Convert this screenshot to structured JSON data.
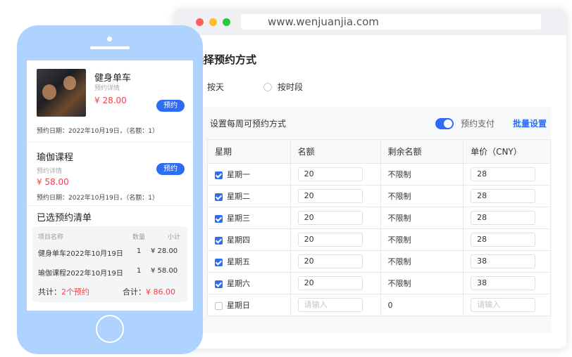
{
  "browser": {
    "url": "www.wenjuanjia.com",
    "section_title": "选择预约方式",
    "modes": [
      {
        "label": "按天",
        "selected": true
      },
      {
        "label": "按时段",
        "selected": false
      }
    ],
    "weekly_title": "设置每周可预约方式",
    "pay_toggle_label": "预约支付",
    "pay_toggle_on": true,
    "batch_label": "批量设置",
    "table": {
      "headers": [
        "星期",
        "名额",
        "剩余名额",
        "单价（CNY）"
      ],
      "rows": [
        {
          "day": "星期一",
          "checked": true,
          "quota": "20",
          "remain": "不限制",
          "price": "28"
        },
        {
          "day": "星期二",
          "checked": true,
          "quota": "20",
          "remain": "不限制",
          "price": "28"
        },
        {
          "day": "星期三",
          "checked": true,
          "quota": "20",
          "remain": "不限制",
          "price": "28"
        },
        {
          "day": "星期四",
          "checked": true,
          "quota": "20",
          "remain": "不限制",
          "price": "28"
        },
        {
          "day": "星期五",
          "checked": true,
          "quota": "20",
          "remain": "不限制",
          "price": "38"
        },
        {
          "day": "星期六",
          "checked": true,
          "quota": "20",
          "remain": "不限制",
          "price": "38"
        },
        {
          "day": "星期日",
          "checked": false,
          "quota": "",
          "remain": "0",
          "price": ""
        }
      ],
      "input_placeholder": "请输入"
    }
  },
  "phone": {
    "items": [
      {
        "title": "健身单车",
        "sub": "预约详情",
        "price": "¥ 28.00",
        "button": "预约",
        "date": "预约日期：2022年10月19日，（名额：1）"
      },
      {
        "title": "瑜伽课程",
        "sub": "预约详情",
        "price": "¥ 58.00",
        "button": "预约",
        "date": "预约日期：2022年10月19日，（名额：1）"
      }
    ],
    "cart_title": "已选预约清单",
    "cart_headers": {
      "name": "项目名称",
      "qty": "数量",
      "subtotal": "小计"
    },
    "cart_rows": [
      {
        "name": "健身单车2022年10月19日",
        "qty": "1",
        "amount": "¥ 28.00"
      },
      {
        "name": "瑜伽课程2022年10月19日",
        "qty": "1",
        "amount": "¥ 58.00"
      }
    ],
    "total_count_label": "共计：",
    "total_count_value": "2个预约",
    "total_amount_label": "合计：",
    "total_amount_value": "¥ 86.00"
  },
  "colors": {
    "accent": "#2d6df6",
    "price": "#f0434b",
    "phone_body": "#aed3ff"
  }
}
